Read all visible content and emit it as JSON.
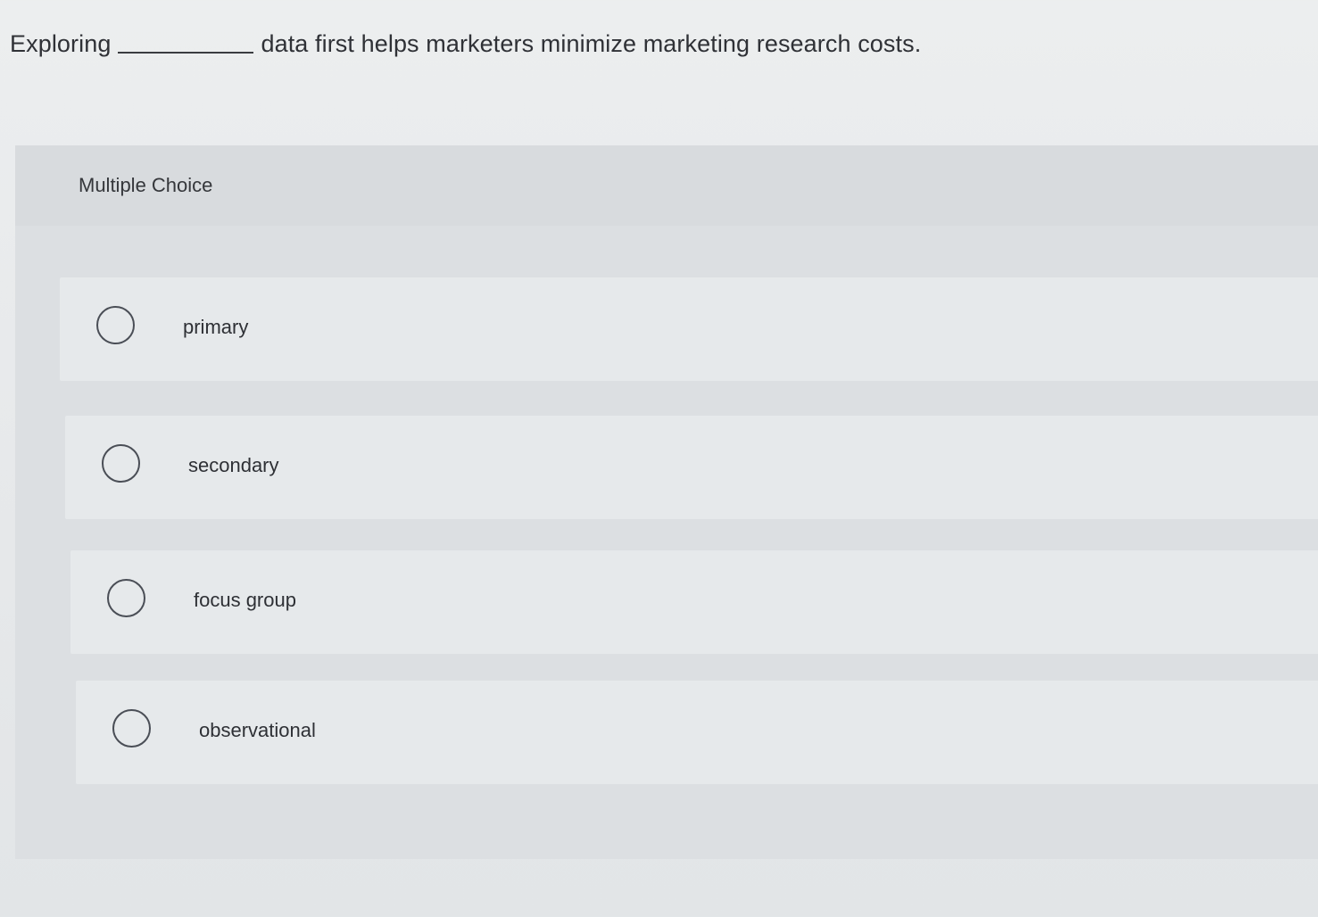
{
  "question": {
    "prefix": "Exploring",
    "suffix": "data first helps marketers minimize marketing research costs."
  },
  "multiple_choice": {
    "header": "Multiple Choice",
    "options": [
      {
        "label": "primary"
      },
      {
        "label": "secondary"
      },
      {
        "label": "focus group"
      },
      {
        "label": "observational"
      }
    ]
  }
}
